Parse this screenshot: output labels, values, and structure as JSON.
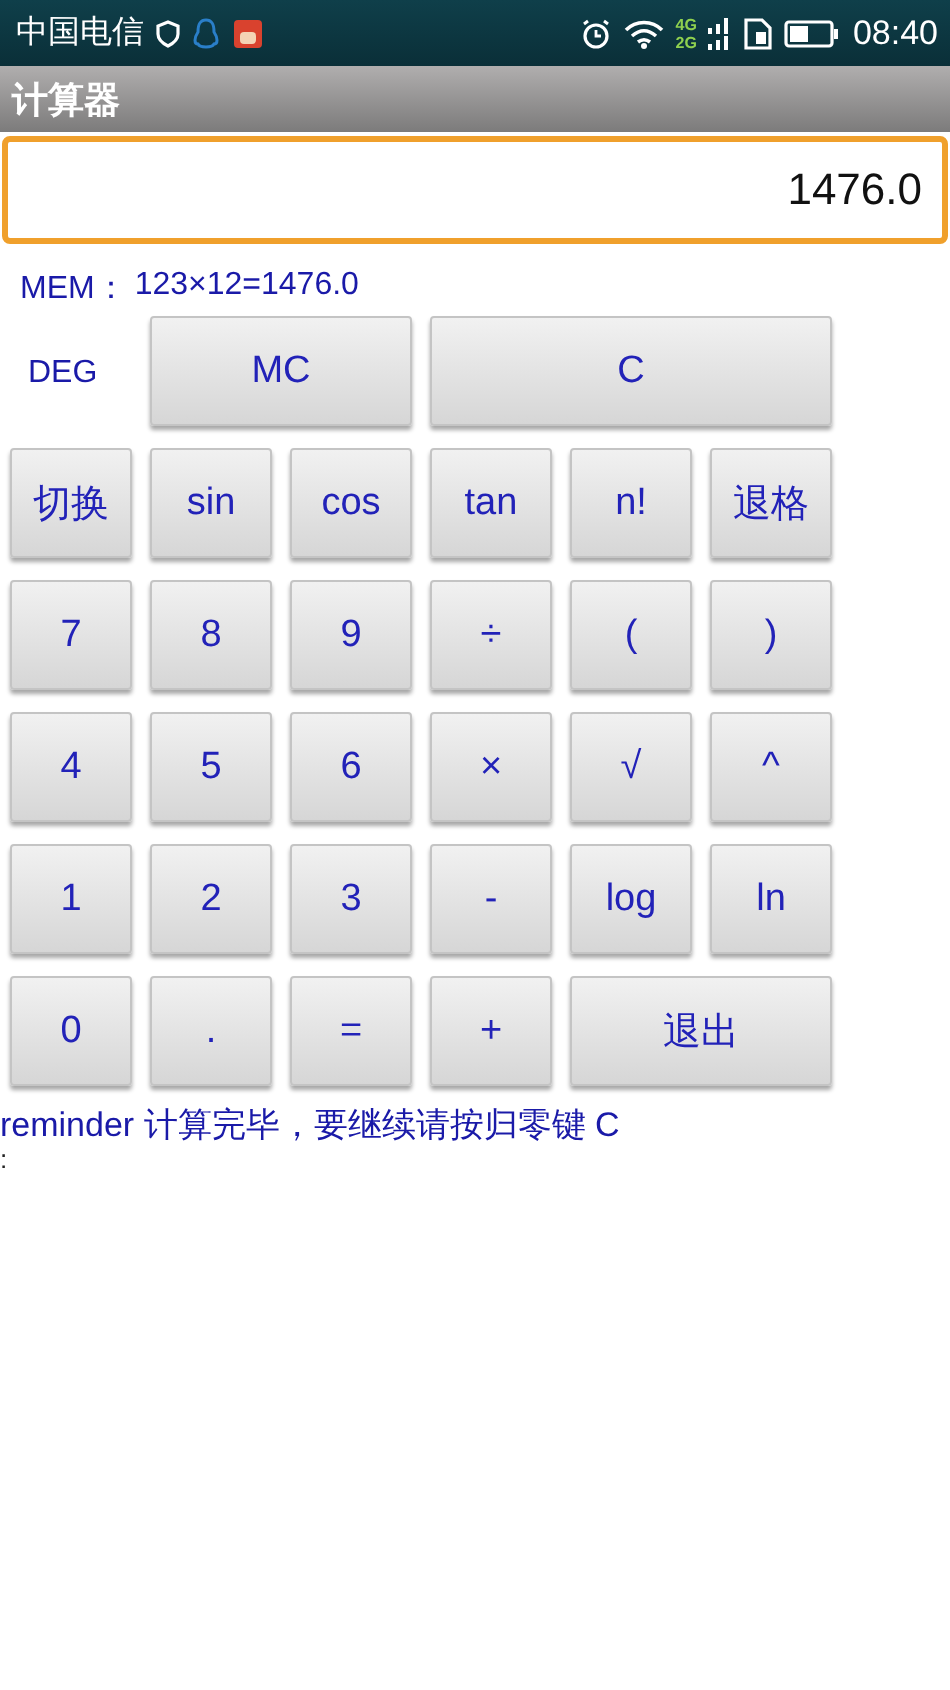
{
  "status_bar": {
    "carrier": "中国电信",
    "network_types": [
      "4G",
      "2G"
    ],
    "time": "08:40"
  },
  "app_bar": {
    "title": "计算器"
  },
  "display": {
    "value": "1476.0"
  },
  "memory": {
    "label": "MEM：",
    "value": "123×12=1476.0"
  },
  "mode_row": {
    "mode": "DEG",
    "keys": [
      {
        "label": "MC",
        "kind": "double"
      },
      {
        "label": "C",
        "kind": "triple"
      }
    ]
  },
  "keypad": {
    "rows": [
      [
        {
          "label": "切换",
          "kind": "key"
        },
        {
          "label": "sin",
          "kind": "key"
        },
        {
          "label": "cos",
          "kind": "key"
        },
        {
          "label": "tan",
          "kind": "key"
        },
        {
          "label": "n!",
          "kind": "key"
        },
        {
          "label": "退格",
          "kind": "key"
        }
      ],
      [
        {
          "label": "7",
          "kind": "key"
        },
        {
          "label": "8",
          "kind": "key"
        },
        {
          "label": "9",
          "kind": "key"
        },
        {
          "label": "÷",
          "kind": "key"
        },
        {
          "label": "(",
          "kind": "key"
        },
        {
          "label": ")",
          "kind": "key"
        }
      ],
      [
        {
          "label": "4",
          "kind": "key"
        },
        {
          "label": "5",
          "kind": "key"
        },
        {
          "label": "6",
          "kind": "key"
        },
        {
          "label": "×",
          "kind": "key"
        },
        {
          "label": "√",
          "kind": "key"
        },
        {
          "label": "^",
          "kind": "key"
        }
      ],
      [
        {
          "label": "1",
          "kind": "key"
        },
        {
          "label": "2",
          "kind": "key"
        },
        {
          "label": "3",
          "kind": "key"
        },
        {
          "label": "-",
          "kind": "key"
        },
        {
          "label": "log",
          "kind": "key"
        },
        {
          "label": "ln",
          "kind": "key"
        }
      ],
      [
        {
          "label": "0",
          "kind": "key"
        },
        {
          "label": ".",
          "kind": "key"
        },
        {
          "label": "=",
          "kind": "key"
        },
        {
          "label": "+",
          "kind": "key"
        },
        {
          "label": "退出",
          "kind": "double"
        }
      ]
    ]
  },
  "reminder": {
    "text": "reminder 计算完毕，要继续请按归零键 C",
    "second_line": ":"
  }
}
